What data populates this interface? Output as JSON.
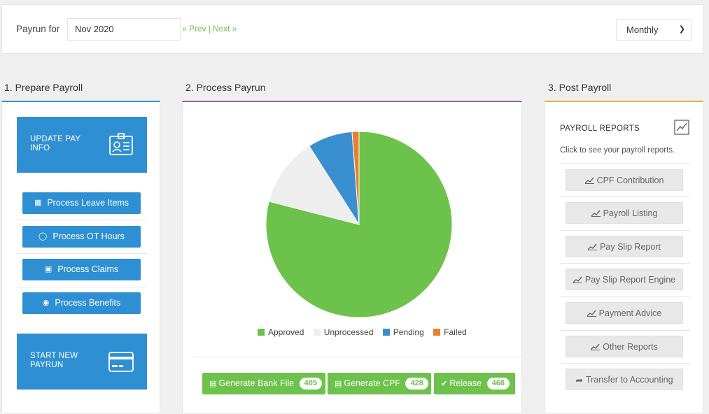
{
  "header": {
    "payrun_label": "Payrun for",
    "period_value": "Nov 2020",
    "prev_label": "« Prev",
    "next_label": "Next »",
    "separator": "|",
    "frequency_value": "Monthly"
  },
  "prepare": {
    "title": "1. Prepare Payroll",
    "update_pay_info": "UPDATE PAY INFO",
    "actions": [
      "Process Leave Items",
      "Process OT Hours",
      "Process Claims",
      "Process Benefits"
    ],
    "start_new_payrun": "START NEW PAYRUN"
  },
  "process": {
    "title": "2. Process Payrun",
    "buttons": [
      {
        "label": "Generate Bank File",
        "count": "405"
      },
      {
        "label": "Generate CPF",
        "count": "428"
      },
      {
        "label": "Release",
        "count": "468"
      }
    ]
  },
  "post": {
    "title": "3. Post Payroll",
    "reports_title": "PAYROLL REPORTS",
    "reports_subtitle": "Click to see your payroll reports.",
    "reports": [
      "CPF Contribution",
      "Payroll Listing",
      "Pay Slip Report",
      "Pay Slip Report Engine",
      "Payment Advice",
      "Other Reports",
      "Transfer to Accounting"
    ]
  },
  "colors": {
    "approved": "#6cc24a",
    "unprocessed": "#eeeeee",
    "pending": "#3a8fd1",
    "failed": "#e8812f"
  },
  "chart_data": {
    "type": "pie",
    "categories": [
      "Approved",
      "Unprocessed",
      "Pending",
      "Failed"
    ],
    "values": [
      79,
      12,
      7.8,
      1.2
    ],
    "legend_position": "bottom"
  }
}
